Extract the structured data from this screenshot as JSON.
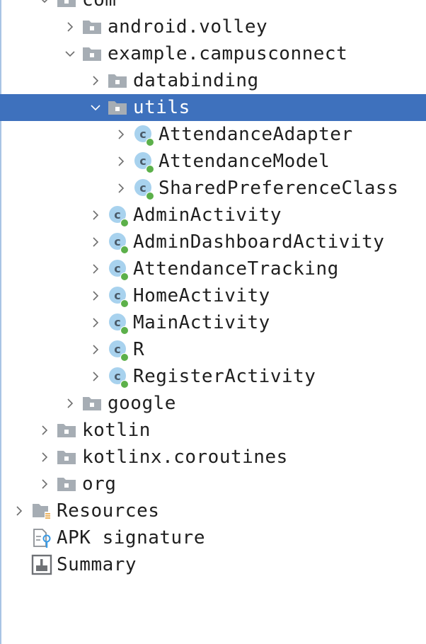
{
  "tree": {
    "items": [
      {
        "label": "com",
        "type": "package",
        "indent": 2,
        "expanded": true,
        "has_arrow": true
      },
      {
        "label": "android.volley",
        "type": "package",
        "indent": 3,
        "expanded": false,
        "has_arrow": true
      },
      {
        "label": "example.campusconnect",
        "type": "package",
        "indent": 3,
        "expanded": true,
        "has_arrow": true
      },
      {
        "label": "databinding",
        "type": "package",
        "indent": 4,
        "expanded": false,
        "has_arrow": true
      },
      {
        "label": "utils",
        "type": "package",
        "indent": 4,
        "expanded": true,
        "has_arrow": true,
        "selected": true
      },
      {
        "label": "AttendanceAdapter",
        "type": "class",
        "indent": 5,
        "expanded": false,
        "has_arrow": true
      },
      {
        "label": "AttendanceModel",
        "type": "class",
        "indent": 5,
        "expanded": false,
        "has_arrow": true
      },
      {
        "label": "SharedPreferenceClass",
        "type": "class",
        "indent": 5,
        "expanded": false,
        "has_arrow": true
      },
      {
        "label": "AdminActivity",
        "type": "class",
        "indent": 4,
        "expanded": false,
        "has_arrow": true
      },
      {
        "label": "AdminDashboardActivity",
        "type": "class",
        "indent": 4,
        "expanded": false,
        "has_arrow": true
      },
      {
        "label": "AttendanceTracking",
        "type": "class",
        "indent": 4,
        "expanded": false,
        "has_arrow": true
      },
      {
        "label": "HomeActivity",
        "type": "class",
        "indent": 4,
        "expanded": false,
        "has_arrow": true
      },
      {
        "label": "MainActivity",
        "type": "class",
        "indent": 4,
        "expanded": false,
        "has_arrow": true
      },
      {
        "label": "R",
        "type": "class",
        "indent": 4,
        "expanded": false,
        "has_arrow": true
      },
      {
        "label": "RegisterActivity",
        "type": "class",
        "indent": 4,
        "expanded": false,
        "has_arrow": true
      },
      {
        "label": "google",
        "type": "package",
        "indent": 3,
        "expanded": false,
        "has_arrow": true
      },
      {
        "label": "kotlin",
        "type": "package",
        "indent": 2,
        "expanded": false,
        "has_arrow": true
      },
      {
        "label": "kotlinx.coroutines",
        "type": "package",
        "indent": 2,
        "expanded": false,
        "has_arrow": true
      },
      {
        "label": "org",
        "type": "package",
        "indent": 2,
        "expanded": false,
        "has_arrow": true
      },
      {
        "label": "Resources",
        "type": "resources",
        "indent": 1,
        "expanded": false,
        "has_arrow": true
      },
      {
        "label": "APK signature",
        "type": "signature",
        "indent": 1,
        "expanded": false,
        "has_arrow": false
      },
      {
        "label": "Summary",
        "type": "summary",
        "indent": 1,
        "expanded": false,
        "has_arrow": false
      }
    ]
  },
  "icons": {
    "package": "package-folder-icon",
    "class": "class-icon",
    "resources": "resources-icon",
    "signature": "apk-signature-icon",
    "summary": "summary-icon"
  },
  "colors": {
    "selection": "#3e71bd",
    "class_circle": "#a8d2ee",
    "class_dot": "#5cb04a",
    "folder": "#a6adb4"
  }
}
